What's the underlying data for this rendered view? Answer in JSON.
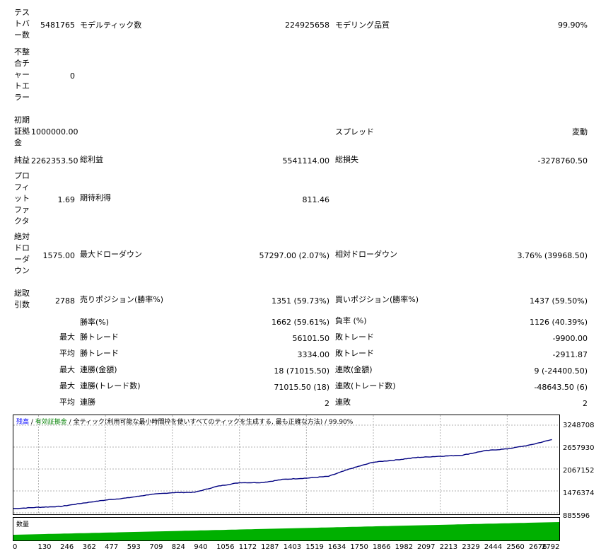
{
  "report": {
    "test_bars_label": "テストバー数",
    "test_bars_value": "5481765",
    "model_ticks_label": "モデルティック数",
    "model_ticks_value": "224925658",
    "modeling_quality_label": "モデリング品質",
    "modeling_quality_value": "99.90%",
    "mismatch_label": "不整合チャートエラー",
    "mismatch_value": "0",
    "initial_deposit_label": "初期証拠金",
    "initial_deposit_value": "1000000.00",
    "spread_label": "スプレッド",
    "spread_value": "変動",
    "net_profit_label": "純益",
    "net_profit_value": "2262353.50",
    "gross_profit_label": "総利益",
    "gross_profit_value": "5541114.00",
    "gross_loss_label": "総損失",
    "gross_loss_value": "-3278760.50",
    "profit_factor_label": "プロフィットファクタ",
    "profit_factor_value": "1.69",
    "expected_payoff_label": "期待利得",
    "expected_payoff_value": "811.46",
    "abs_drawdown_label": "絶対ドローダウン",
    "abs_drawdown_value": "1575.00",
    "max_drawdown_label": "最大ドローダウン",
    "max_drawdown_value": "57297.00 (2.07%)",
    "rel_drawdown_label": "相対ドローダウン",
    "rel_drawdown_value": "3.76% (39968.50)",
    "total_trades_label": "総取引数",
    "total_trades_value": "2788",
    "short_positions_label": "売りポジション(勝率%)",
    "short_positions_value": "1351 (59.73%)",
    "long_positions_label": "買いポジション(勝率%)",
    "long_positions_value": "1437 (59.50%)",
    "win_rate_label": "勝率(%)",
    "win_rate_value": "1662 (59.61%)",
    "loss_rate_label": "負率 (%)",
    "loss_rate_value": "1126 (40.39%)",
    "max_label": "最大",
    "avg_label": "平均",
    "largest_win_label": "勝トレード",
    "largest_win_value": "56101.50",
    "largest_loss_label": "敗トレード",
    "largest_loss_value": "-9900.00",
    "avg_win_label": "勝トレード",
    "avg_win_value": "3334.00",
    "avg_loss_label": "敗トレード",
    "avg_loss_value": "-2911.87",
    "max_consec_wins_money_label": "連勝(金額)",
    "max_consec_wins_money_value": "18 (71015.50)",
    "max_consec_losses_money_label": "連敗(金額)",
    "max_consec_losses_money_value": "9 (-24400.50)",
    "max_consec_wins_count_label": "連勝(トレード数)",
    "max_consec_wins_count_value": "71015.50 (18)",
    "max_consec_losses_count_label": "連敗(トレード数)",
    "max_consec_losses_count_value": "-48643.50 (6)",
    "avg_consec_wins_label": "連勝",
    "avg_consec_wins_value": "2",
    "avg_consec_losses_label": "連敗",
    "avg_consec_losses_value": "2"
  },
  "chart_legend": {
    "balance": "残高",
    "sep1": " / ",
    "equity": "有効証拠金",
    "sep2": " / ",
    "mode": "全ティック(利用可能な最小時間枠を使いすべてのティックを生成する, 最も正確な方法)",
    "sep3": " / ",
    "quality": "99.90%"
  },
  "volume_label": "数量",
  "colors": {
    "balance": "#000080",
    "legend_balance": "#0000ff",
    "legend_equity": "#008000",
    "volume": "#00b000",
    "grid": "#b0b0b0"
  },
  "chart_data": {
    "type": "line",
    "x": [
      0,
      130,
      246,
      362,
      477,
      593,
      709,
      824,
      940,
      1056,
      1172,
      1287,
      1403,
      1519,
      1634,
      1750,
      1866,
      1982,
      2097,
      2213,
      2329,
      2444,
      2560,
      2676,
      2792
    ],
    "series": [
      {
        "name": "残高",
        "values": [
          1000000,
          1035000,
          1060000,
          1150000,
          1230000,
          1290000,
          1380000,
          1430000,
          1440000,
          1600000,
          1700000,
          1700000,
          1790000,
          1820000,
          1870000,
          2080000,
          2250000,
          2310000,
          2380000,
          2410000,
          2440000,
          2560000,
          2610000,
          2710000,
          2860000
        ]
      }
    ],
    "volume_values": [
      1,
      1,
      1,
      1,
      1,
      1,
      1,
      1,
      1,
      1,
      1,
      1,
      1,
      1,
      1,
      1,
      1,
      1,
      1,
      1,
      1,
      1,
      1,
      1,
      1
    ],
    "yticks": [
      "3248708",
      "2657930",
      "2067152",
      "1476374",
      "885596"
    ],
    "xticks": [
      "0",
      "130",
      "246",
      "362",
      "477",
      "593",
      "709",
      "824",
      "940",
      "1056",
      "1172",
      "1287",
      "1403",
      "1519",
      "1634",
      "1750",
      "1866",
      "1982",
      "2097",
      "2213",
      "2329",
      "2444",
      "2560",
      "2676",
      "2792"
    ],
    "ylim": [
      885596,
      3248708
    ],
    "xlim": [
      0,
      2830
    ],
    "grid": true
  }
}
